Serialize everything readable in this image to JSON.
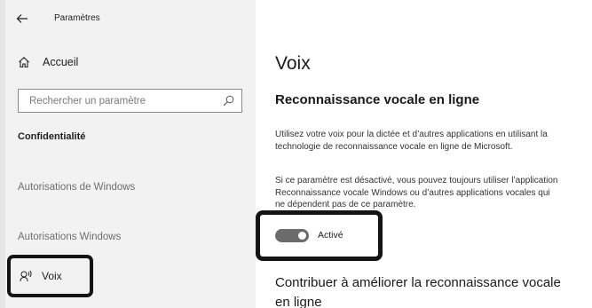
{
  "window": {
    "title": "Paramètres"
  },
  "sidebar": {
    "home_label": "Accueil",
    "search_placeholder": "Rechercher un paramètre",
    "section_label": "Confidentialité",
    "items": [
      {
        "label": "Autorisations de Windows"
      },
      {
        "label": "Autorisations Windows"
      },
      {
        "label": "Voix",
        "selected": true,
        "icon": "speech-icon"
      }
    ]
  },
  "main": {
    "title": "Voix",
    "subtitle": "Reconnaissance vocale en ligne",
    "paragraph1": {
      "line1": "Utilisez votre voix pour la dictée et d’autres applications en utilisant la",
      "line2": "technologie de reconnaissance vocale en ligne de Microsoft."
    },
    "paragraph2": {
      "line1": "Si ce paramètre est désactivé, vous pouvez toujours utiliser l’application",
      "line2": "Reconnaissance vocale Windows ou d’autres applications vocales qui",
      "line3": "ne dépendent pas de ce paramètre."
    },
    "toggle": {
      "label": "Activé",
      "on": true
    },
    "contrib_title": {
      "line1": "Contribuer à améliorer la reconnaissance vocale",
      "line2": "en ligne"
    }
  },
  "colors": {
    "sidebar_bg": "#f2f2f2",
    "highlight_border": "#141414",
    "toggle_on": "#6b6b6b"
  }
}
